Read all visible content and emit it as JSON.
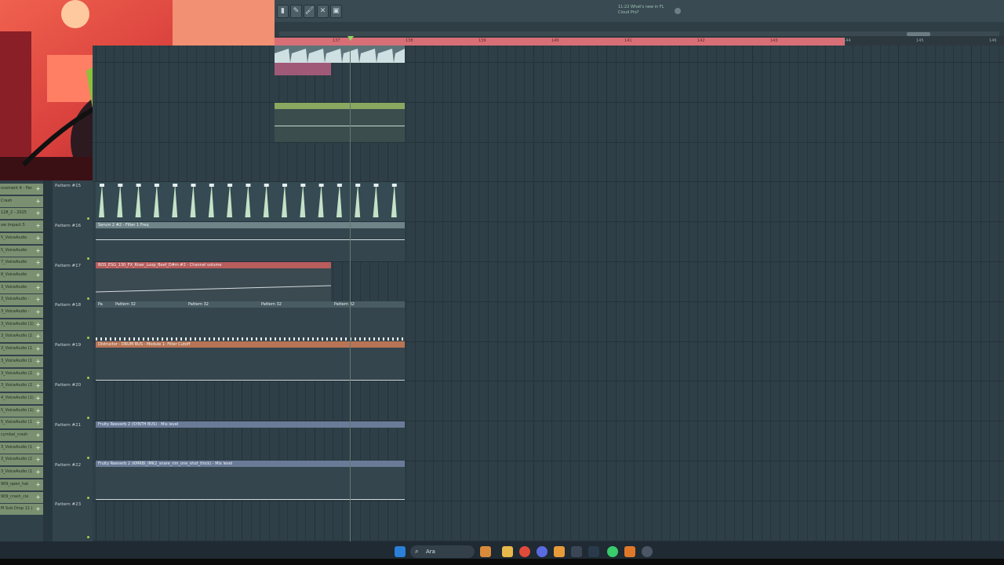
{
  "toolbar": {
    "news_text": "What's new in FL Cloud Pro?",
    "news_time": "11:22"
  },
  "ruler": {
    "ticks": [
      "137",
      "138",
      "139",
      "140",
      "141",
      "142",
      "143",
      "144",
      "145",
      "146"
    ]
  },
  "patterns": [
    "Pattern #15",
    "Pattern #16",
    "Pattern #17",
    "Pattern #18",
    "Pattern #19",
    "Pattern #20",
    "Pattern #21",
    "Pattern #22",
    "Pattern #23"
  ],
  "clips": {
    "serum": "Serum 2 #2 - Filter 1 Freq",
    "riser": "BOS_ESG_130_FX_Riser_Loop_Beef_D#m #2 - Channel volume",
    "pat32": "Pattern 32",
    "pat32_short": "Pa",
    "distructor": "Distructor - DRUM BUS - Module 1: Filter Cutoff",
    "reverb1": "Fruity Reeverb 2 (SYNTH BUS) - Mix level",
    "reverb2": "Fruity Reeverb 2 (KMRBI_IMK2_snare_rim_one_shot_thick) - Mix level"
  },
  "channels": [
    "ncement 4 - Par",
    "Crash",
    "128_2 - 2025",
    "ow Impact 5",
    "5_VoiceAudio",
    "5_VoiceAudio",
    "7_VoiceAudio",
    "8_VoiceAudio",
    "3_VoiceAudio",
    "3_VoiceAudio -",
    "3_VoiceAudio -",
    "3_VoiceAudio (1)",
    "3_VoiceAudio (2",
    "3_VoiceAudio (1",
    "3_VoiceAudio (1",
    "3_VoiceAudio (2",
    "3_VoiceAudio (2",
    "4_VoiceAudio (1)",
    "5_VoiceAudio (1)",
    "5_VoiceAudio (1",
    "cymbal_crash",
    "3_VoiceAudio (1",
    "3_VoiceAudio (2",
    "3_VoiceAudio (1",
    "909_open_hat",
    "909_crash_cle",
    "M Sub Drop 11 ("
  ],
  "taskbar": {
    "search_placeholder": "Ara"
  },
  "colors": {
    "loop_region": "#d86f76",
    "pattern_clip": "#6e8489",
    "automation_green": "#8aa860",
    "automation_blue": "#6a7b98",
    "automation_orange": "#b87454",
    "automation_red": "#b85c5c"
  }
}
